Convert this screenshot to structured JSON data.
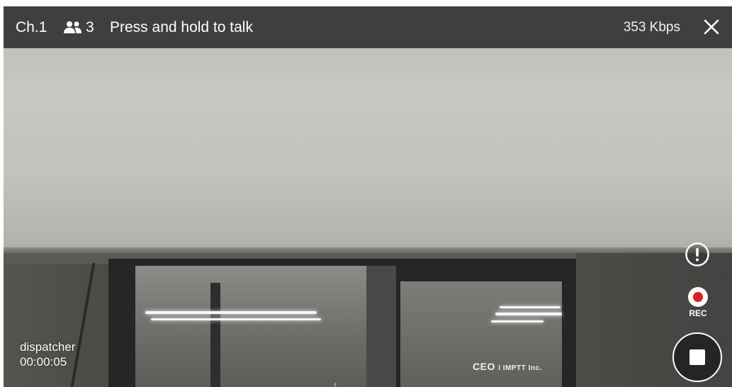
{
  "topbar": {
    "channel": "Ch.1",
    "member_count": "3",
    "ptt_hint": "Press and hold to talk",
    "bitrate": "353 Kbps",
    "members_icon": "group-icon",
    "close_icon": "close-icon"
  },
  "video": {
    "sign_text_main": "CEO",
    "sign_text_sub": "I IMPTT Inc."
  },
  "controls": {
    "alert_icon": "alert-icon",
    "rec_label": "REC",
    "rec_color": "#e01e1e",
    "stop_icon": "stop-icon"
  },
  "caller": {
    "name": "dispatcher",
    "duration": "00:00:05"
  },
  "colors": {
    "topbar_bg": "#343434",
    "accent_red": "#e01e1e",
    "text": "#ffffff"
  }
}
